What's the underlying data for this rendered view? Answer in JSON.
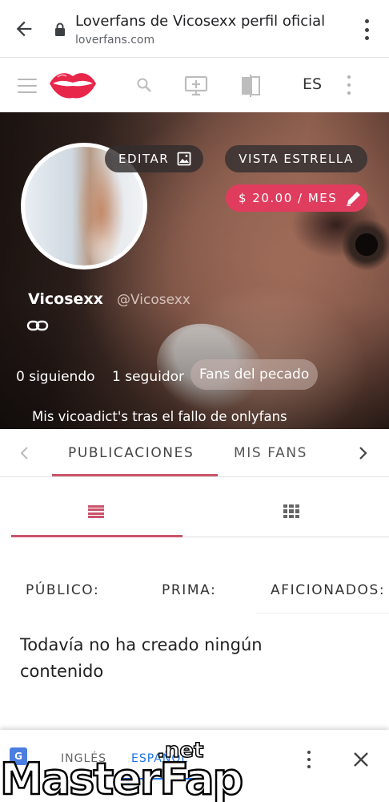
{
  "browser": {
    "title": "Loverfans de Vicosexx perfil oficial",
    "url": "loverfans.com"
  },
  "toolbar": {
    "language": "ES"
  },
  "profile": {
    "edit_label": "EDITAR",
    "star_view_label": "VISTA ESTRELLA",
    "price_label": "$ 20.00 / MES",
    "name": "Vicosexx",
    "handle": "@Vicosexx",
    "following": "0 siguiendo",
    "followers": "1 seguidor",
    "tag": "Fans del pecado",
    "bio": "Mis vicoadict's tras el fallo de onlyfans"
  },
  "tabs": {
    "publications": "PUBLICACIONES",
    "my_fans": "MIS FANS"
  },
  "filters": {
    "public": "PÚBLICO:",
    "premium": "PRIMA:",
    "fans": "AFICIONADOS:"
  },
  "content": {
    "empty_message": "Todavía no ha creado ningún contenido"
  },
  "translate": {
    "english": "INGLÉS",
    "spanish": "ESPAÑOL"
  },
  "watermark": {
    "main": "MasterFap",
    "suffix": ".net"
  },
  "colors": {
    "accent": "#e03c5e",
    "tab_accent": "#c9546b",
    "translate_accent": "#1a73e8"
  }
}
